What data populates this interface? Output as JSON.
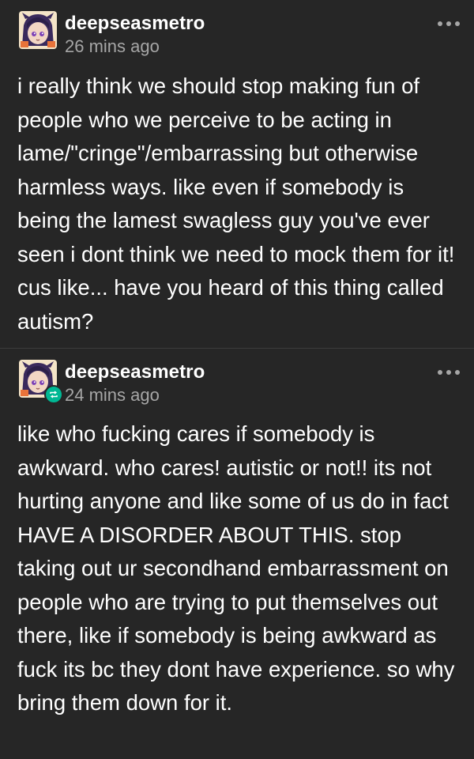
{
  "posts": [
    {
      "username": "deepseasmetro",
      "timestamp": "26 mins ago",
      "is_reblog": false,
      "text": "i really think we should stop making fun of people who we perceive to be acting in lame/\"cringe\"/embarrassing but otherwise harmless ways. like even if somebody is being the lamest swagless guy you've ever seen i dont think we need to mock them for it! cus like... have you heard of this thing called autism?"
    },
    {
      "username": "deepseasmetro",
      "timestamp": "24 mins ago",
      "is_reblog": true,
      "text": "like who fucking cares if somebody is awkward. who cares! autistic or not!! its not hurting anyone and like some of us do in fact HAVE A DISORDER ABOUT THIS. stop taking out ur secondhand embarrassment on people who are trying to put themselves out there, like if somebody is being awkward as fuck its bc they dont have experience. so why bring them down for it."
    }
  ],
  "icons": {
    "avatar": "avatar-icon",
    "more": "more-options-icon",
    "reblog": "reblog-icon"
  },
  "colors": {
    "background": "#262626",
    "text": "#ffffff",
    "muted": "#a6a6a6",
    "divider": "#3c3c3c",
    "reblog_badge": "#00b894"
  }
}
